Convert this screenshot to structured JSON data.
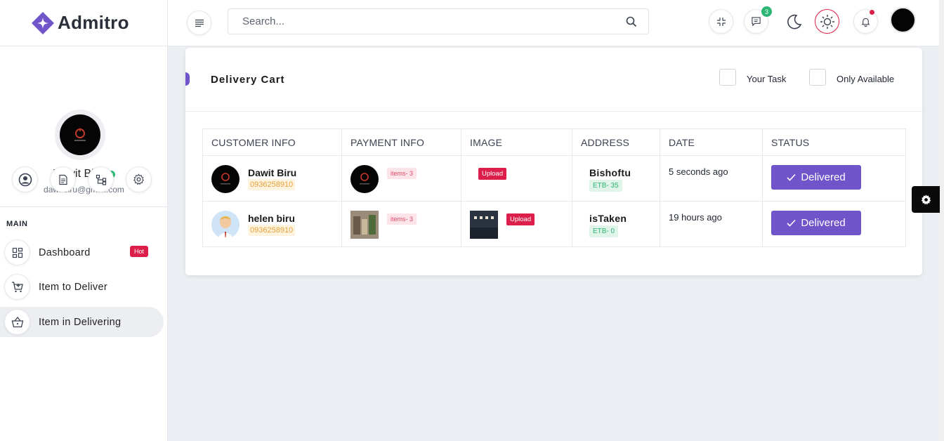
{
  "app": {
    "logo_text": "Admitro",
    "brand_color": "#6f55c9",
    "accent_red": "#dc1e4a",
    "accent_green": "#2bb673"
  },
  "profile": {
    "name": "Dawit Biru",
    "email": "dawitbiru@gmail.com"
  },
  "profile_actions": [
    "user-icon",
    "document-icon",
    "sitemap-icon",
    "settings-icon"
  ],
  "sidebar": {
    "section_label": "MAIN",
    "items": [
      {
        "label": "Dashboard",
        "icon": "dashboard-icon",
        "badge": "Hot",
        "active": false
      },
      {
        "label": "Item to Deliver",
        "icon": "cart-icon",
        "active": false
      },
      {
        "label": "Item in Delivering",
        "icon": "basket-icon",
        "active": true
      }
    ]
  },
  "header": {
    "search_placeholder": "Search...",
    "messages_count": "3"
  },
  "card": {
    "title": "Delivery Cart",
    "filters": [
      {
        "label": "Your Task"
      },
      {
        "label": "Only Available"
      }
    ]
  },
  "table": {
    "columns": [
      "CUSTOMER INFO",
      "PAYMENT INFO",
      "IMAGE",
      "ADDRESS",
      "DATE",
      "STATUS"
    ],
    "rows": [
      {
        "customer_name": "Dawit Biru",
        "phone": "0936258910",
        "items": "items- 3",
        "image_badge": "Upload",
        "address": "Bishoftu",
        "price": "ETB- 35",
        "date": "5 seconds ago",
        "status": "Delivered"
      },
      {
        "customer_name": "helen biru",
        "phone": "0936258910",
        "items": "items- 3",
        "image_badge": "Upload",
        "address": "isTaken",
        "price": "ETB- 0",
        "date": "19 hours ago",
        "status": "Delivered"
      }
    ]
  }
}
